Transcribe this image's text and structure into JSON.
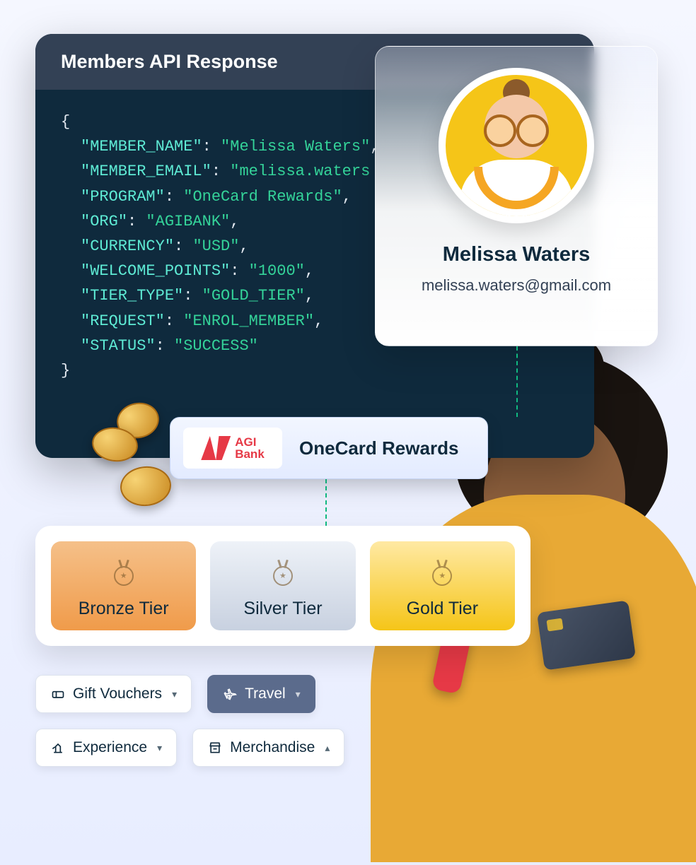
{
  "api": {
    "title": "Members API Response",
    "fields": [
      {
        "key": "MEMBER_NAME",
        "value": "Melissa Waters"
      },
      {
        "key": "MEMBER_EMAIL",
        "value": "melissa.waters"
      },
      {
        "key": "PROGRAM",
        "value": "OneCard Rewards"
      },
      {
        "key": "ORG",
        "value": "AGIBANK"
      },
      {
        "key": "CURRENCY",
        "value": "USD"
      },
      {
        "key": "WELCOME_POINTS",
        "value": "1000"
      },
      {
        "key": "TIER_TYPE",
        "value": "GOLD_TIER"
      },
      {
        "key": "REQUEST",
        "value": "ENROL_MEMBER"
      },
      {
        "key": "STATUS",
        "value": "SUCCESS"
      }
    ]
  },
  "profile": {
    "name": "Melissa Waters",
    "email": "melissa.waters@gmail.com"
  },
  "program": {
    "bank_line1": "AGI",
    "bank_line2": "Bank",
    "name": "OneCard Rewards"
  },
  "tiers": {
    "bronze": "Bronze Tier",
    "silver": "Silver Tier",
    "gold": "Gold Tier"
  },
  "categories": {
    "gift_vouchers": "Gift Vouchers",
    "travel": "Travel",
    "experience": "Experience",
    "merchandise": "Merchandise"
  }
}
